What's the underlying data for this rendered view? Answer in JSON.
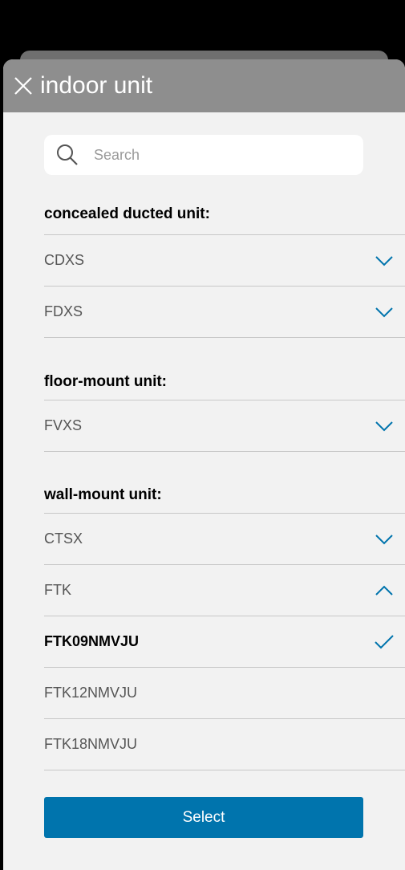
{
  "header": {
    "title": "indoor unit"
  },
  "search": {
    "placeholder": "Search"
  },
  "sections": [
    {
      "title": "concealed ducted unit:",
      "items": [
        {
          "label": "CDXS",
          "icon": "chevron-down-icon"
        },
        {
          "label": "FDXS",
          "icon": "chevron-down-icon"
        }
      ]
    },
    {
      "title": "floor-mount unit:",
      "items": [
        {
          "label": "FVXS",
          "icon": "chevron-down-icon"
        }
      ]
    },
    {
      "title": "wall-mount unit:",
      "items": [
        {
          "label": "CTSX",
          "icon": "chevron-down-icon"
        },
        {
          "label": "FTK",
          "icon": "chevron-up-icon"
        },
        {
          "label": "FTK09NMVJU",
          "icon": "checkmark-icon",
          "selected": true
        },
        {
          "label": "FTK12NMVJU"
        },
        {
          "label": "FTK18NMVJU"
        }
      ]
    }
  ],
  "actions": {
    "select_label": "Select"
  },
  "colors": {
    "accent": "#0074ad",
    "header_bg": "#8e8e8e",
    "sheet_bg": "#f2f2f2"
  }
}
